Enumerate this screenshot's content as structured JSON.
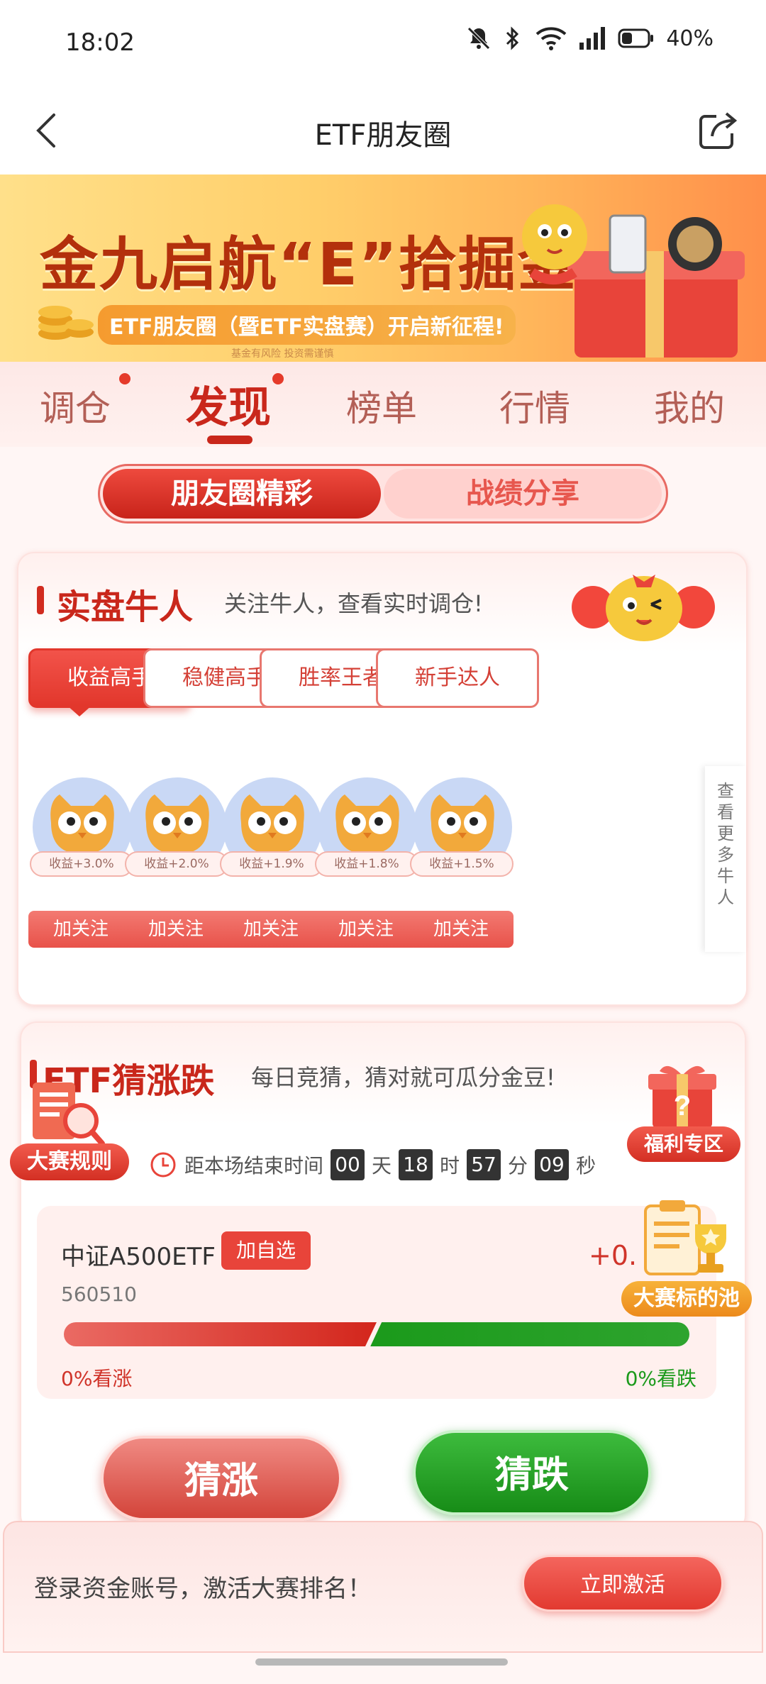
{
  "status": {
    "time": "18:02",
    "battery": "40%"
  },
  "nav": {
    "title": "ETF朋友圈"
  },
  "banner": {
    "title": "金九启航“E”拾掘金",
    "subtitle": "ETF朋友圈（暨ETF实盘赛）开启新征程!",
    "fine_print": "基金有风险  投资需谨慎"
  },
  "main_tabs": [
    "调仓",
    "发现",
    "榜单",
    "行情",
    "我的"
  ],
  "segment": {
    "left": "朋友圈精彩",
    "right": "战绩分享"
  },
  "experts": {
    "title": "实盘牛人",
    "desc": "关注牛人，查看实时调仓!",
    "filters": [
      "收益高手",
      "稳健高手",
      "胜率王者",
      "新手达人"
    ],
    "users": [
      {
        "tag": "收益+3.0%",
        "button": "加关注"
      },
      {
        "tag": "收益+2.0%",
        "button": "加关注"
      },
      {
        "tag": "收益+1.9%",
        "button": "加关注"
      },
      {
        "tag": "收益+1.8%",
        "button": "加关注"
      },
      {
        "tag": "收益+1.5%",
        "button": "加关注"
      }
    ],
    "more": "查看更多牛人"
  },
  "guess": {
    "title": "ETF猜涨跌",
    "desc": "每日竞猜，猜对就可瓜分金豆!",
    "rules": "大赛规则",
    "welfare": "福利专区",
    "pool": "大赛标的池",
    "timer_label": "距本场结束时间",
    "timer": {
      "days": "00",
      "hours": "18",
      "minutes": "57",
      "seconds": "09"
    },
    "units": {
      "day": "天",
      "hour": "时",
      "minute": "分",
      "second": "秒"
    },
    "etf": {
      "name": "中证A500ETF",
      "add": "加自选",
      "code": "560510",
      "change": "+0.",
      "up_text": "0%看涨",
      "down_text": "0%看跌"
    },
    "up_button": "猜涨",
    "down_button": "猜跌"
  },
  "login": {
    "text": "登录资金账号，激活大赛排名！",
    "button": "立即激活"
  }
}
